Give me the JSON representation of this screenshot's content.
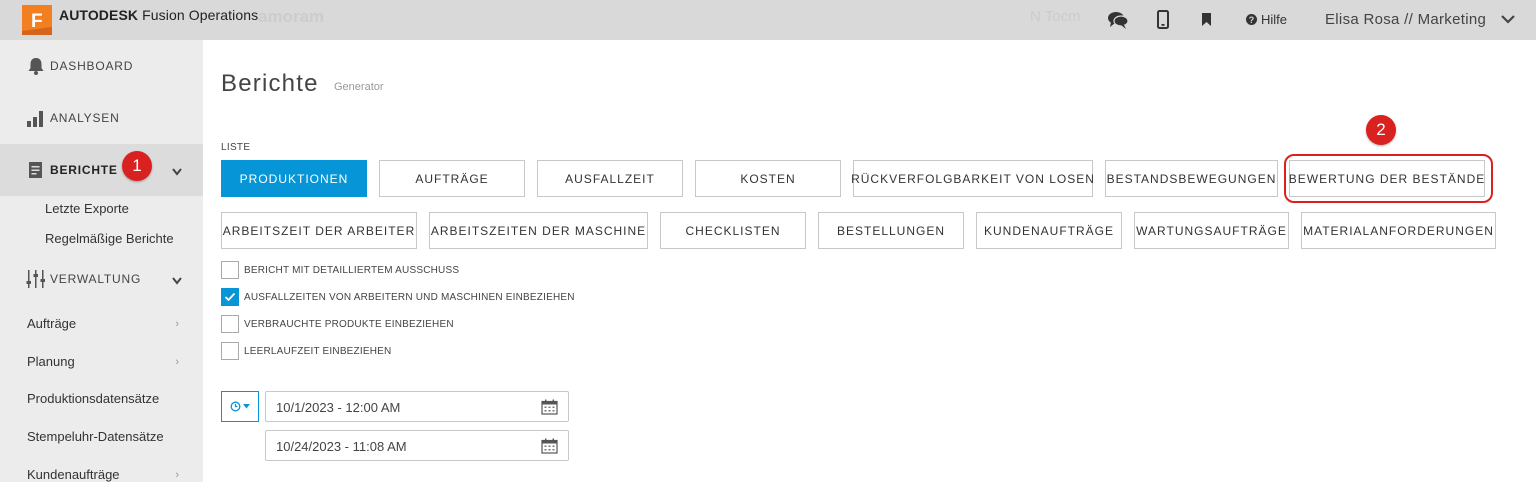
{
  "topbar": {
    "brand_bold": "AUTODESK",
    "brand_rest": "Fusion Operations",
    "ghost_left": "amoram",
    "ghost_right": "N Tocm",
    "help": "Hilfe",
    "user": "Elisa Rosa // Marketing",
    "icons": [
      "chat-icon",
      "mobile-icon",
      "bookmark-icon",
      "help-icon",
      "chevron-down-icon"
    ]
  },
  "sidebar": {
    "dashboard": "DASHBOARD",
    "analysen": "ANALYSEN",
    "berichte": "BERICHTE",
    "berichte_sub": [
      "Letzte Exporte",
      "Regelmäßige Berichte"
    ],
    "verwaltung": "VERWALTUNG",
    "verwaltung_sub": [
      "Aufträge",
      "Planung",
      "Produktionsdatensätze",
      "Stempeluhr-Datensätze",
      "Kundenaufträge"
    ]
  },
  "annotations": {
    "badge1": "1",
    "badge2": "2",
    "badge_color": "#d9221f"
  },
  "main": {
    "title": "Berichte",
    "subtitle": "Generator",
    "list_label": "LISTE",
    "row1": [
      "PRODUKTIONEN",
      "AUFTRÄGE",
      "AUSFALLZEIT",
      "KOSTEN",
      "RÜCKVERFOLGBARKEIT VON LOSEN",
      "BESTANDSBEWEGUNGEN",
      "BEWERTUNG DER BESTÄNDE"
    ],
    "row2": [
      "ARBEITSZEIT DER ARBEITER",
      "ARBEITSZEITEN DER MASCHINE",
      "CHECKLISTEN",
      "BESTELLUNGEN",
      "KUNDENAUFTRÄGE",
      "WARTUNGSAUFTRÄGE",
      "MATERIALANFORDERUNGEN"
    ],
    "active_report": "PRODUKTIONEN",
    "accent": "#0696d7",
    "checkboxes": [
      {
        "label": "BERICHT MIT DETAILLIERTEM AUSSCHUSS",
        "checked": false
      },
      {
        "label": "AUSFALLZEITEN VON ARBEITERN UND MASCHINEN EINBEZIEHEN",
        "checked": true
      },
      {
        "label": "VERBRAUCHTE PRODUKTE EINBEZIEHEN",
        "checked": false
      },
      {
        "label": "LEERLAUFZEIT EINBEZIEHEN",
        "checked": false
      }
    ],
    "date_from": "10/1/2023 - 12:00 AM",
    "date_to": "10/24/2023 - 11:08 AM"
  }
}
